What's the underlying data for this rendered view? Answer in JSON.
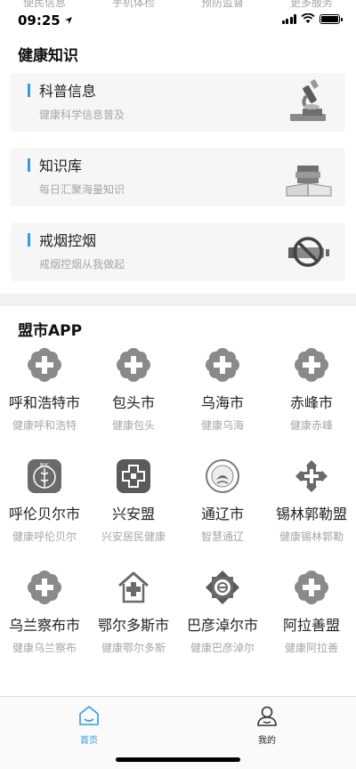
{
  "status": {
    "time": "09:25",
    "ghost_tabs": [
      "便民信息",
      "手机体检",
      "预防监督",
      "更多服务"
    ]
  },
  "knowledge": {
    "title": "健康知识",
    "cards": [
      {
        "title": "科普信息",
        "subtitle": "健康科学信息普及",
        "icon": "microscope-icon"
      },
      {
        "title": "知识库",
        "subtitle": "每日汇聚海量知识",
        "icon": "books-icon"
      },
      {
        "title": "戒烟控烟",
        "subtitle": "戒烟控烟从我做起",
        "icon": "no-smoking-icon"
      }
    ]
  },
  "apps": {
    "title": "盟市APP",
    "items": [
      {
        "name": "呼和浩特市",
        "sub": "健康呼和浩特",
        "icon": "flower-cross-icon"
      },
      {
        "name": "包头市",
        "sub": "健康包头",
        "icon": "flower-cross-icon"
      },
      {
        "name": "乌海市",
        "sub": "健康乌海",
        "icon": "flower-cross-icon"
      },
      {
        "name": "赤峰市",
        "sub": "健康赤峰",
        "icon": "flower-cross-icon"
      },
      {
        "name": "呼伦贝尔市",
        "sub": "健康呼伦贝尔",
        "icon": "nhc-icon"
      },
      {
        "name": "兴安盟",
        "sub": "兴安居民健康",
        "icon": "hospital-cross-icon"
      },
      {
        "name": "通辽市",
        "sub": "智慧通辽",
        "icon": "seal-icon"
      },
      {
        "name": "锡林郭勒盟",
        "sub": "健康锡林郭勒",
        "icon": "diamond-cross-icon"
      },
      {
        "name": "乌兰察布市",
        "sub": "健康乌兰察布",
        "icon": "flower-cross-icon"
      },
      {
        "name": "鄂尔多斯市",
        "sub": "健康鄂尔多斯",
        "icon": "house-cross-icon"
      },
      {
        "name": "巴彦淖尔市",
        "sub": "健康巴彦淖尔",
        "icon": "square-emblem-icon"
      },
      {
        "name": "阿拉善盟",
        "sub": "健康阿拉善",
        "icon": "flower-cross-icon"
      }
    ]
  },
  "tabbar": {
    "home": "首页",
    "mine": "我的"
  },
  "colors": {
    "accent": "#2f9ce0",
    "icon_gray": "#8a8a8a"
  }
}
